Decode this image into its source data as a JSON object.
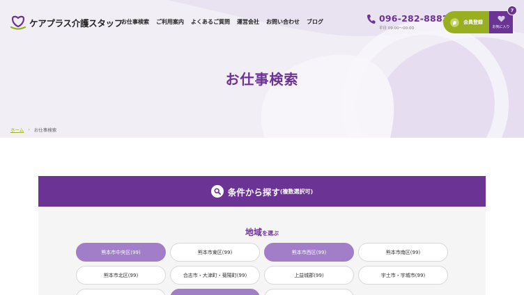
{
  "header": {
    "logo_text": "ケアプラス介護スタッフ",
    "nav": [
      "お仕事検索",
      "ご利用案内",
      "よくあるご質問",
      "運営会社",
      "お問い合わせ",
      "ブログ"
    ],
    "phone": "096-282-8882",
    "phone_hours": "平日 09:00〜00:00",
    "member_label": "会員登録",
    "favorites_label": "お気に入り",
    "favorites_count": "7"
  },
  "hero": {
    "title": "お仕事検索"
  },
  "breadcrumb": {
    "home": "ホーム",
    "separator": "›",
    "current": "お仕事検索"
  },
  "search": {
    "title": "条件から探す",
    "note": "(複数選択可)",
    "area_heading": "地域",
    "area_heading_suffix": "を選ぶ",
    "areas": [
      {
        "label": "熊本市中央区(99)",
        "selected": true
      },
      {
        "label": "熊本市東区(99)",
        "selected": false
      },
      {
        "label": "熊本市西区(99)",
        "selected": true
      },
      {
        "label": "熊本市南区(99)",
        "selected": false
      },
      {
        "label": "熊本市北区(99)",
        "selected": false
      },
      {
        "label": "合志市・大津町・菊陽町(99)",
        "selected": false
      },
      {
        "label": "上益城郡(99)",
        "selected": false
      },
      {
        "label": "宇土市・宇城市(99)",
        "selected": false
      }
    ],
    "partial_row_selected": [
      false,
      true,
      false
    ]
  },
  "colors": {
    "brand_purple": "#6a3394",
    "accent_green": "#9aaf1f",
    "pill_selected": "#a27dc8"
  }
}
